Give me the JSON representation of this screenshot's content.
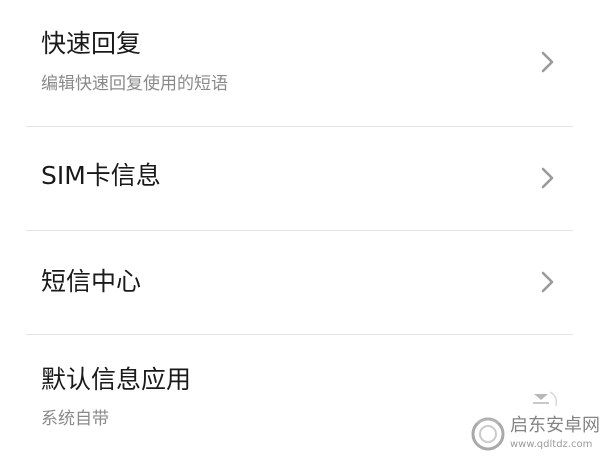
{
  "settings": {
    "items": [
      {
        "title": "快速回复",
        "subtitle": "编辑快速回复使用的短语",
        "has_chevron": true
      },
      {
        "title": "SIM卡信息",
        "has_chevron": true
      },
      {
        "title": "短信中心",
        "has_chevron": true
      },
      {
        "title": "默认信息应用",
        "subtitle": "系统自带",
        "has_chevron": false
      }
    ]
  },
  "watermark": {
    "name": "启东安卓网",
    "url": "www.qdltdz.com"
  },
  "colors": {
    "title": "#1a1a1a",
    "subtitle": "#8a8a8a",
    "chevron": "#9a9a9a",
    "divider": "#e3e3e3",
    "background": "#ffffff"
  },
  "icons": {
    "row_chevron": "chevron-right-icon",
    "watermark_logo": "magnifier-logo-icon"
  }
}
